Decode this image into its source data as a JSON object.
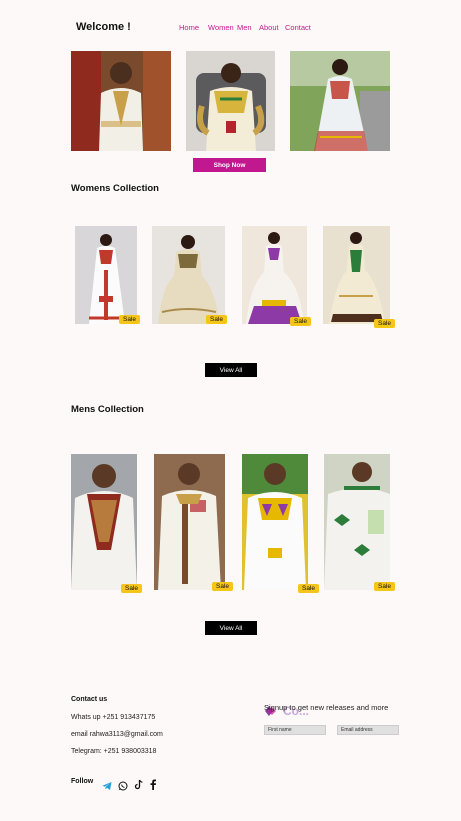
{
  "header": {
    "welcome": "Welcome !",
    "nav": [
      "Home",
      "Women",
      "Men",
      "About",
      "Contact"
    ]
  },
  "hero": {
    "shop_now": "Shop Now"
  },
  "womens": {
    "title": "Womens Collection",
    "sale_label": "Sale",
    "view_all": "View All"
  },
  "mens": {
    "title": "Mens Collection",
    "sale_label": "Sale",
    "view_all": "View All"
  },
  "footer": {
    "contact_title": "Contact us",
    "whatsapp": "Whats up  +251 913437175",
    "email": "email  rahwa3113@gmail.com",
    "telegram": "Telegram: +251 938003318",
    "follow": "Follow",
    "logo_text": "Co...",
    "signup": "Signup to get new releases and more",
    "first_name_placeholder": "First name",
    "email_placeholder": "Email address"
  },
  "colors": {
    "accent": "#c2188f",
    "sale_badge": "#f5c518",
    "background": "#fdf9f8"
  }
}
